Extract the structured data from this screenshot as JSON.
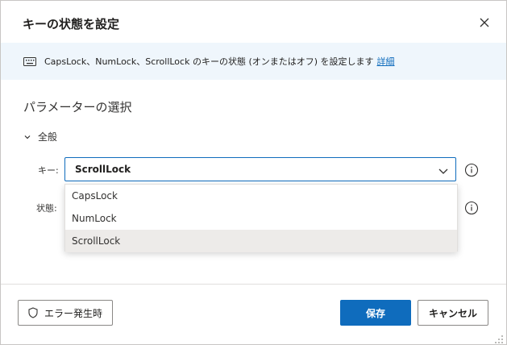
{
  "dialog": {
    "title": "キーの状態を設定",
    "close_icon": "close-icon"
  },
  "info": {
    "icon": "keyboard-icon",
    "text": "CapsLock、NumLock、ScrollLock のキーの状態 (オンまたはオフ) を設定します",
    "link": "詳細"
  },
  "params": {
    "title": "パラメーターの選択",
    "group_label": "全般",
    "key_label": "キー:",
    "state_label": "状態:",
    "key_value": "ScrollLock",
    "options": [
      "CapsLock",
      "NumLock",
      "ScrollLock"
    ],
    "selected_option": "ScrollLock"
  },
  "footer": {
    "error_button": "エラー発生時",
    "save_button": "保存",
    "cancel_button": "キャンセル"
  },
  "colors": {
    "accent": "#0f6cbd",
    "info_background": "#eff6fc",
    "selected_option_background": "#edebe9"
  }
}
